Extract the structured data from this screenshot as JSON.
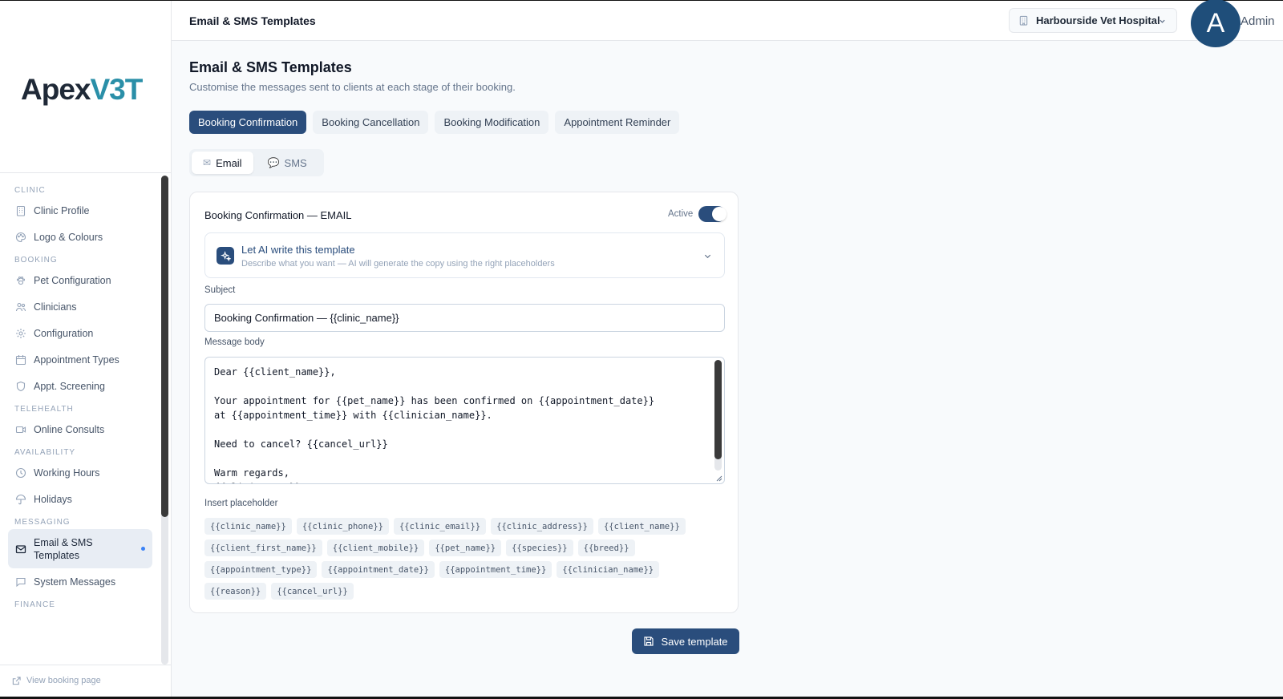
{
  "app": {
    "logo_part1": "Apex",
    "logo_part2": "V3T",
    "brand_color": "#2a8fa8",
    "accent_color": "#2a4d7c"
  },
  "topbar": {
    "title": "Email & SMS Templates",
    "clinic": "Harbourside Vet Hospital",
    "avatar_initial": "A",
    "user_label": "Admin"
  },
  "sidebar": {
    "sections": [
      {
        "label": "CLINIC",
        "items": [
          {
            "label": "Clinic Profile",
            "icon": "building-icon"
          },
          {
            "label": "Logo & Colours",
            "icon": "palette-icon"
          }
        ]
      },
      {
        "label": "BOOKING",
        "items": [
          {
            "label": "Pet Configuration",
            "icon": "paw-icon"
          },
          {
            "label": "Clinicians",
            "icon": "users-icon"
          },
          {
            "label": "Configuration",
            "icon": "gear-icon"
          },
          {
            "label": "Appointment Types",
            "icon": "calendar-icon"
          },
          {
            "label": "Appt. Screening",
            "icon": "shield-icon"
          }
        ]
      },
      {
        "label": "TELEHEALTH",
        "items": [
          {
            "label": "Online Consults",
            "icon": "video-icon"
          }
        ]
      },
      {
        "label": "AVAILABILITY",
        "items": [
          {
            "label": "Working Hours",
            "icon": "clock-icon"
          },
          {
            "label": "Holidays",
            "icon": "umbrella-icon"
          }
        ]
      },
      {
        "label": "MESSAGING",
        "items": [
          {
            "label": "Email & SMS Templates",
            "icon": "mail-icon",
            "active": true
          },
          {
            "label": "System Messages",
            "icon": "chat-icon"
          }
        ]
      },
      {
        "label": "FINANCE",
        "items": []
      }
    ],
    "footer_link": "View booking page"
  },
  "main": {
    "title": "Email & SMS Templates",
    "subtitle": "Customise the messages sent to clients at each stage of their booking.",
    "tabs": [
      "Booking Confirmation",
      "Booking Cancellation",
      "Booking Modification",
      "Appointment Reminder"
    ],
    "active_tab": 0,
    "channels": [
      {
        "label": "Email",
        "icon": "envelope-icon"
      },
      {
        "label": "SMS",
        "icon": "speech-bubble-icon"
      }
    ],
    "active_channel": 0
  },
  "editor": {
    "title": "Booking Confirmation — EMAIL",
    "active_label": "Active",
    "active": true,
    "ai": {
      "title": "Let AI write this template",
      "description": "Describe what you want — AI will generate the copy using the right placeholders"
    },
    "subject_label": "Subject",
    "subject_value": "Booking Confirmation — {{clinic_name}}",
    "body_label": "Message body",
    "body_value": "Dear {{client_name}},\n\nYour appointment for {{pet_name}} has been confirmed on {{appointment_date}}\nat {{appointment_time}} with {{clinician_name}}.\n\nNeed to cancel? {{cancel_url}}\n\nWarm regards,\n{{clinic_name}}",
    "placeholder_label": "Insert placeholder",
    "placeholders": [
      "{{clinic_name}}",
      "{{clinic_phone}}",
      "{{clinic_email}}",
      "{{clinic_address}}",
      "{{client_name}}",
      "{{client_first_name}}",
      "{{client_mobile}}",
      "{{pet_name}}",
      "{{species}}",
      "{{breed}}",
      "{{appointment_type}}",
      "{{appointment_date}}",
      "{{appointment_time}}",
      "{{clinician_name}}",
      "{{reason}}",
      "{{cancel_url}}"
    ],
    "save_label": "Save template"
  }
}
